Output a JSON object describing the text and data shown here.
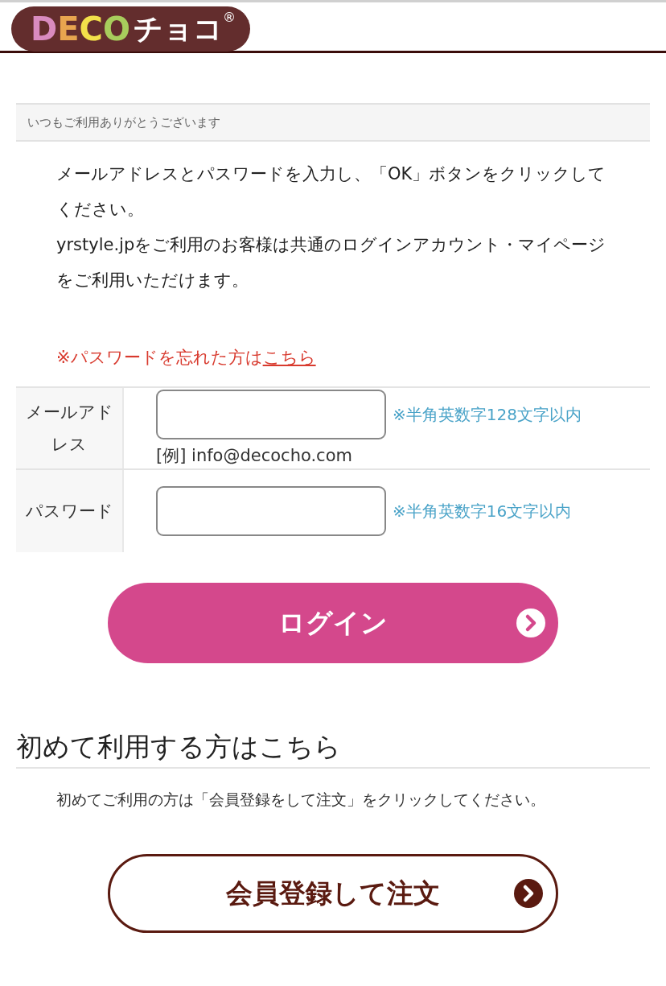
{
  "logo": {
    "letters": [
      {
        "text": "D",
        "color": "#d98bbf"
      },
      {
        "text": "E",
        "color": "#e8a54f"
      },
      {
        "text": "C",
        "color": "#f2e04a"
      },
      {
        "text": "O",
        "color": "#a8cc5c"
      }
    ],
    "suffix": "チョコ",
    "mark": "®"
  },
  "notice": "いつもご利用ありがとうございます",
  "intro": [
    "メールアドレスとパスワードを入力し、「OK」ボタンをクリックしてください。",
    "yrstyle.jpをご利用のお客様は共通のログインアカウント・マイページをご利用いただけます。"
  ],
  "forgot": {
    "text": "※パスワードを忘れた方は",
    "link": "こちら"
  },
  "fields": [
    {
      "label": "メールアドレス",
      "hint": "※半角英数字128文字以内",
      "example": "[例] info@decocho.com"
    },
    {
      "label": "パスワード",
      "hint": "※半角英数字16文字以内"
    }
  ],
  "login_button": "ログイン",
  "first_time": {
    "heading": "初めて利用する方はこちら",
    "text": "初めてご利用の方は「会員登録をして注文」をクリックしてください。",
    "button": "会員登録して注文"
  }
}
